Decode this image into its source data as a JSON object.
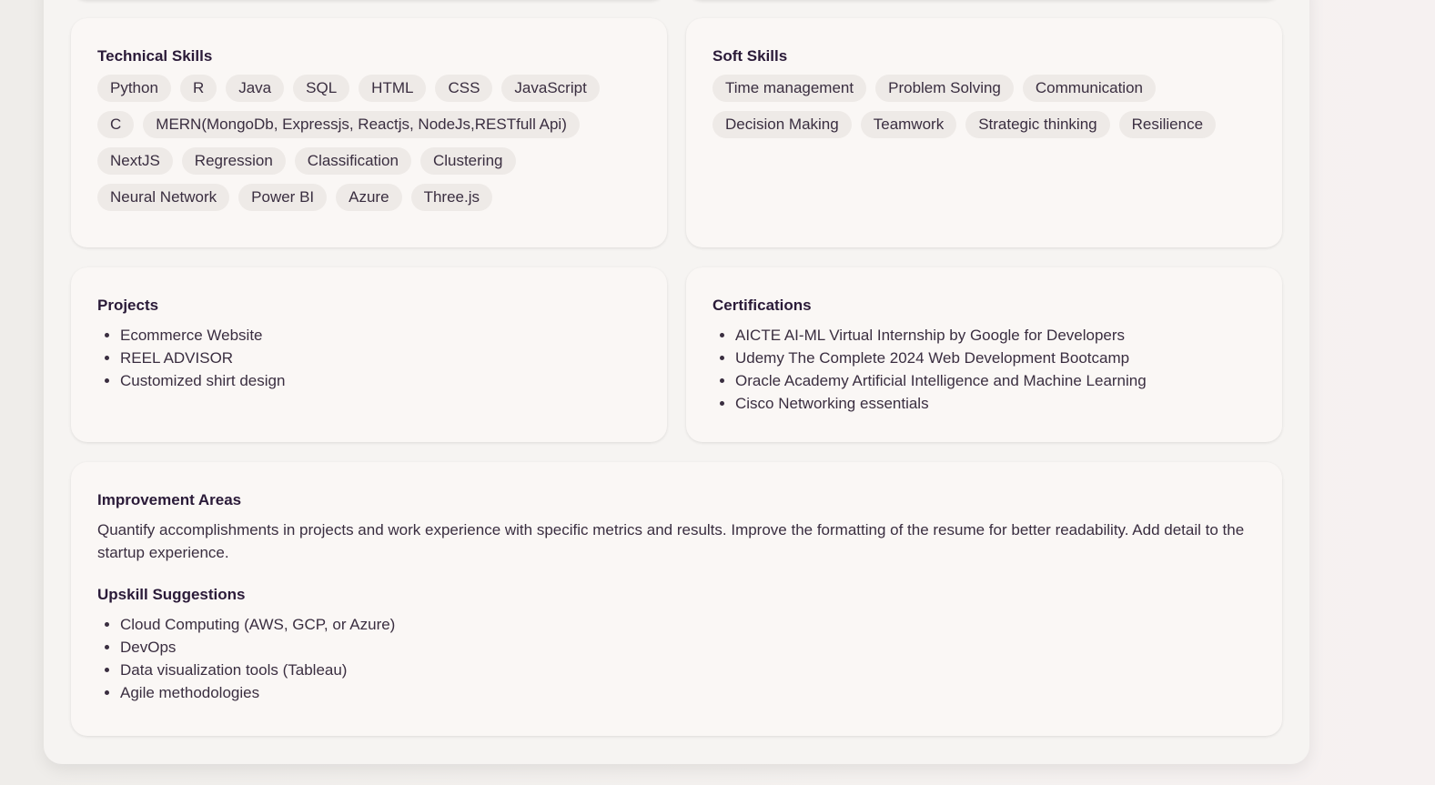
{
  "technical_skills": {
    "title": "Technical Skills",
    "items": [
      "Python",
      "R",
      "Java",
      "SQL",
      "HTML",
      "CSS",
      "JavaScript",
      "C",
      "MERN(MongoDb, Expressjs, Reactjs, NodeJs,RESTfull Api)",
      "NextJS",
      "Regression",
      "Classification",
      "Clustering",
      "Neural Network",
      "Power BI",
      "Azure",
      "Three.js"
    ]
  },
  "soft_skills": {
    "title": "Soft Skills",
    "items": [
      "Time management",
      "Problem Solving",
      "Communication",
      "Decision Making",
      "Teamwork",
      "Strategic thinking",
      "Resilience"
    ]
  },
  "projects": {
    "title": "Projects",
    "items": [
      "Ecommerce Website",
      "REEL ADVISOR",
      "Customized shirt design"
    ]
  },
  "certifications": {
    "title": "Certifications",
    "items": [
      "AICTE AI-ML Virtual Internship by Google for Developers",
      "Udemy The Complete 2024 Web Development Bootcamp",
      "Oracle Academy Artificial Intelligence and Machine Learning",
      "Cisco Networking essentials"
    ]
  },
  "improvement": {
    "title": "Improvement Areas",
    "text": "Quantify accomplishments in projects and work experience with specific metrics and results. Improve the formatting of the resume for better readability. Add detail to the startup experience."
  },
  "upskill": {
    "title": "Upskill Suggestions",
    "items": [
      "Cloud Computing (AWS, GCP, or Azure)",
      "DevOps",
      "Data visualization tools (Tableau)",
      "Agile methodologies"
    ]
  }
}
